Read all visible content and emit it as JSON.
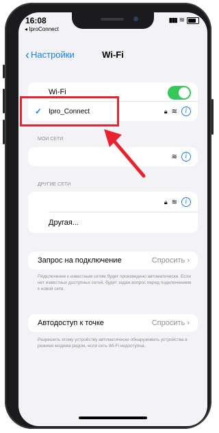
{
  "status": {
    "time": "16:08",
    "back_app": "◂ IproConnect"
  },
  "nav": {
    "back_label": "Настройки",
    "title": "Wi-Fi"
  },
  "wifi": {
    "label": "Wi-Fi",
    "enabled": true
  },
  "connected_network": {
    "name": "Ipro_Connect"
  },
  "my_networks": {
    "header": "МОИ СЕТИ"
  },
  "other_networks": {
    "header": "ДРУГИЕ СЕТИ",
    "other_label": "Другая..."
  },
  "ask_to_join": {
    "label": "Запрос на подключение",
    "value": "Спросить",
    "footer": "Подключение к известным сетям будет произведено автоматически. Если нет известных доступных сетей, будет задан вопрос перед подключением к новой сети."
  },
  "hotspot": {
    "label": "Автодоступ к точке",
    "value": "Спросить",
    "footer": "Разрешить этому устройству автоматически обнаруживать устройства в режиме модема рядом, если сеть Wi-Fi недоступна."
  },
  "colors": {
    "accent": "#147efb",
    "toggle_on": "#34c759",
    "highlight": "#e8232d"
  }
}
